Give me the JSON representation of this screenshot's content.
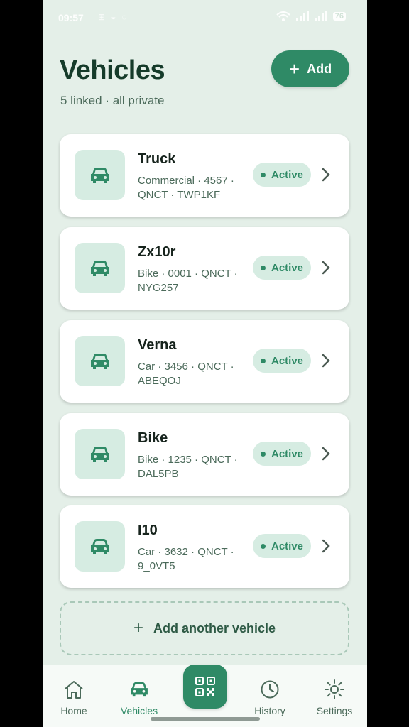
{
  "status_bar": {
    "time": "09:57",
    "battery": "76"
  },
  "header": {
    "title": "Vehicles",
    "subtitle": "5 linked · all private",
    "add_label": "Add"
  },
  "vehicles": [
    {
      "name": "Truck",
      "meta": "Commercial · 4567 · QNCT · TWP1KF",
      "status": "Active"
    },
    {
      "name": "Zx10r",
      "meta": "Bike · 0001 · QNCT · NYG257",
      "status": "Active"
    },
    {
      "name": "Verna",
      "meta": "Car · 3456 · QNCT · ABEQOJ",
      "status": "Active"
    },
    {
      "name": "Bike",
      "meta": "Bike · 1235 · QNCT · DAL5PB",
      "status": "Active"
    },
    {
      "name": "I10",
      "meta": "Car · 3632 · QNCT · 9_0VT5",
      "status": "Active"
    }
  ],
  "add_another_label": "Add another vehicle",
  "nav": {
    "home": "Home",
    "vehicles": "Vehicles",
    "history": "History",
    "settings": "Settings",
    "active_tab": "Vehicles"
  },
  "colors": {
    "accent": "#2f8a66",
    "background": "#e4efe8",
    "title": "#153b2a"
  }
}
